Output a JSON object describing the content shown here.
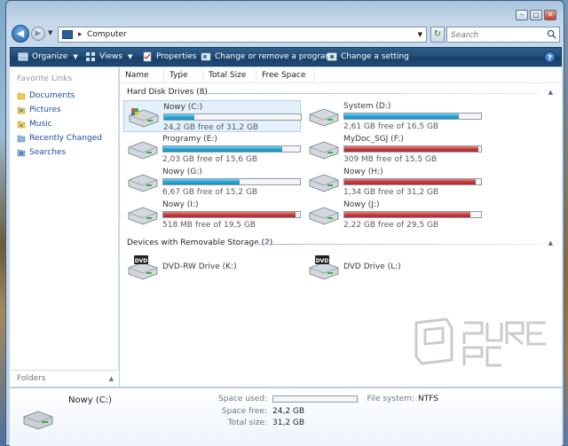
{
  "window": {
    "caption_minimize": "–",
    "caption_maximize": "□",
    "caption_close": "✕"
  },
  "address": {
    "path": "Computer",
    "search_placeholder": "Search"
  },
  "toolbar": {
    "organize": "Organize",
    "views": "Views",
    "properties": "Properties",
    "change_program": "Change or remove a program",
    "change_setting": "Change a setting",
    "help": "?"
  },
  "nav": {
    "title": "Favorite Links",
    "items": [
      "Documents",
      "Pictures",
      "Music",
      "Recently Changed",
      "Searches"
    ],
    "folders_label": "Folders"
  },
  "columns": [
    "Name",
    "Type",
    "Total Size",
    "Free Space"
  ],
  "groups": {
    "hdd": "Hard Disk Drives (8)",
    "removable": "Devices with Removable Storage (2)"
  },
  "drives": [
    {
      "name": "Nowy (C:)",
      "free": "24,2 GB free of 31,2 GB",
      "used": 0.22,
      "color": "blue"
    },
    {
      "name": "System (D:)",
      "free": "2,61 GB free of 16,5 GB",
      "used": 0.84,
      "color": "blue"
    },
    {
      "name": "Programy (E:)",
      "free": "2,03 GB free of 15,6 GB",
      "used": 0.87,
      "color": "blue"
    },
    {
      "name": "MyDoc_SGJ (F:)",
      "free": "309 MB free of 15,5 GB",
      "used": 0.98,
      "color": "red"
    },
    {
      "name": "Nowy (G:)",
      "free": "6,67 GB free of 15,2 GB",
      "used": 0.56,
      "color": "blue"
    },
    {
      "name": "Nowy (H:)",
      "free": "1,34 GB free of 31,2 GB",
      "used": 0.96,
      "color": "red"
    },
    {
      "name": "Nowy (I:)",
      "free": "518 MB free of 19,5 GB",
      "used": 0.97,
      "color": "red"
    },
    {
      "name": "Nowy (J:)",
      "free": "2,22 GB free of 29,5 GB",
      "used": 0.92,
      "color": "red"
    }
  ],
  "removable": [
    {
      "name": "DVD-RW Drive (K:)"
    },
    {
      "name": "DVD Drive (L:)"
    }
  ],
  "details": {
    "name": "Nowy (C:)",
    "space_used_label": "Space used:",
    "space_used": 0.22,
    "space_free_label": "Space free:",
    "space_free": "24,2 GB",
    "total_size_label": "Total size:",
    "total_size": "31,2 GB",
    "file_system_label": "File system:",
    "file_system": "NTFS"
  },
  "watermark": "PURE PC",
  "colors": {
    "blue_bar": "#2aa3d6",
    "red_bar": "#c63a3a",
    "toolbar": "#204c78"
  }
}
